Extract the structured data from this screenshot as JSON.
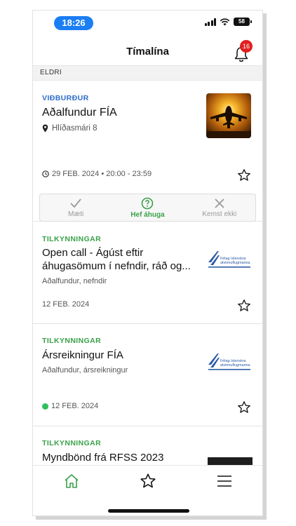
{
  "status_bar": {
    "time": "18:26",
    "battery": "58"
  },
  "header": {
    "title": "Tímalína",
    "notification_count": "16"
  },
  "section": {
    "label": "ELDRI"
  },
  "cards": [
    {
      "category": "VIÐBURÐUR",
      "title": "Aðalfundur FÍA",
      "location": "Hlíðasmári 8",
      "date": "29 FEB. 2024 • 20:00 - 23:59",
      "rsvp": [
        {
          "label": "Mæti",
          "icon": "check-icon"
        },
        {
          "label": "Hef áhuga",
          "icon": "question-circle-icon"
        },
        {
          "label": "Kemst ekki",
          "icon": "x-icon"
        }
      ]
    },
    {
      "category": "TILKYNNINGAR",
      "title_line1": "Open call - Ágúst eftir",
      "title_line2": "áhugasömum í nefndir, ráð og...",
      "tags": "Aðalfundur, nefndir",
      "date": "12 FEB. 2024"
    },
    {
      "category": "TILKYNNINGAR",
      "title": "Ársreikningur FÍA",
      "tags": "Aðalfundur, ársreikningur",
      "date": "12 FEB. 2024"
    },
    {
      "category": "TILKYNNINGAR",
      "title": "Myndbönd frá RFSS 2023"
    }
  ],
  "logo_text": {
    "line1": "Félag íslenskra",
    "line2": "atvinnuflugmanna"
  },
  "tabs": [
    {
      "name": "home",
      "icon": "home-icon"
    },
    {
      "name": "favorites",
      "icon": "star-icon"
    },
    {
      "name": "menu",
      "icon": "menu-icon"
    }
  ],
  "colors": {
    "accent_blue": "#2d6ccb",
    "accent_green": "#3aa14a",
    "badge_red": "#e02020",
    "time_pill": "#1b7ef3"
  }
}
